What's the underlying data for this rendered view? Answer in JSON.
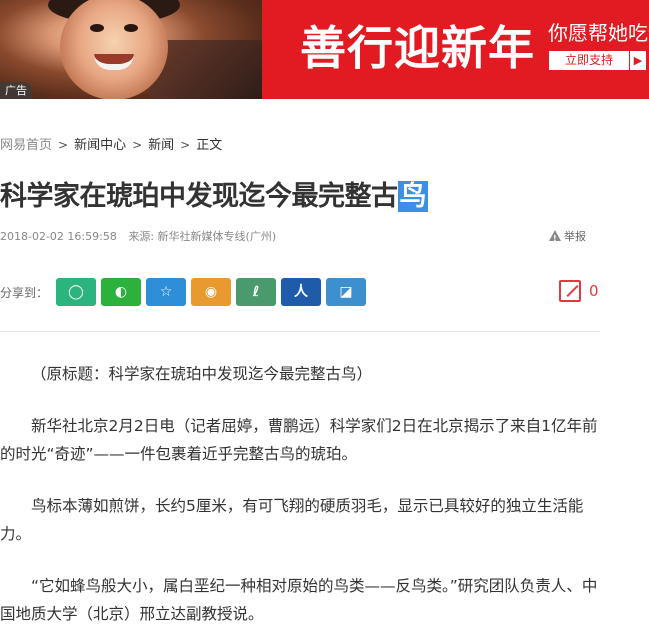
{
  "banner": {
    "ad_tag": "广告",
    "title": "善行迎新年",
    "subtitle": "你愿帮她吃饱",
    "button_label": "立即支持",
    "button_arrow": "▶",
    "brand_color": "#e21b22"
  },
  "breadcrumb": {
    "items": [
      "网易首页",
      "新闻中心",
      "新闻",
      "正文"
    ],
    "separator": ">"
  },
  "article": {
    "title_main": "科学家在琥珀中发现迄今最完整古",
    "title_selected": "鸟",
    "timestamp": "2018-02-02 16:59:58",
    "source": "来源: 新华社新媒体专线(广州)",
    "report_label": "举报",
    "share_label": "分享到：",
    "share_buttons": [
      {
        "name": "qzone",
        "glyph": "◯",
        "color": "#2bb57d"
      },
      {
        "name": "wechat",
        "glyph": "◐",
        "color": "#2cb13c"
      },
      {
        "name": "favorite",
        "glyph": "☆",
        "color": "#2f8ed8"
      },
      {
        "name": "weibo",
        "glyph": "◉",
        "color": "#e99a2f"
      },
      {
        "name": "yixin",
        "glyph": "ℓ",
        "color": "#4a9a6e"
      },
      {
        "name": "renren",
        "glyph": "人",
        "color": "#1e5ba8"
      },
      {
        "name": "lofter",
        "glyph": "◪",
        "color": "#3d8fce"
      }
    ],
    "comment_count": "0",
    "paragraphs": [
      "（原标题：科学家在琥珀中发现迄今最完整古鸟）",
      "新华社北京2月2日电（记者屈婷，曹鹏远）科学家们2日在北京揭示了来自1亿年前的时光“奇迹”——一件包裹着近乎完整古鸟的琥珀。",
      "鸟标本薄如煎饼，长约5厘米，有可飞翔的硬质羽毛，显示已具较好的独立生活能力。",
      "“它如蜂鸟般大小，属白垩纪一种相对原始的鸟类——反鸟类。”研究团队负责人、中国地质大学（北京）邢立达副教授说。"
    ]
  }
}
